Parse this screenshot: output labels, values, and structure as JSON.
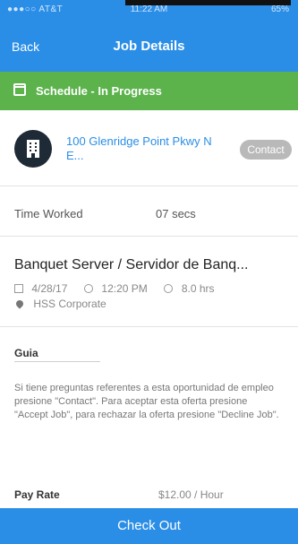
{
  "status_bar": {
    "carrier": "●●●○○ AT&T",
    "time": "11:22 AM",
    "battery": "65%"
  },
  "header": {
    "back_label": "Back",
    "title": "Job Details"
  },
  "schedule": {
    "label": "Schedule - In Progress"
  },
  "location": {
    "address": "100 Glenridge Point Pkwy N E...",
    "contact_label": "Contact"
  },
  "time_worked": {
    "label": "Time Worked",
    "value": "07 secs"
  },
  "job": {
    "title": "Banquet Server / Servidor de Banq...",
    "date": "4/28/17",
    "time": "12:20 PM",
    "hours": "8.0 hrs",
    "company": "HSS Corporate"
  },
  "guia": {
    "label": "Guia",
    "text": "Si tiene preguntas referentes a esta oportunidad de empleo presione \"Contact\". Para aceptar esta oferta presione \"Accept Job\", para rechazar la oferta presione \"Decline Job\"."
  },
  "pay": {
    "label": "Pay Rate",
    "value": "$12.00 / Hour"
  },
  "footer": {
    "checkout_label": "Check Out"
  },
  "colors": {
    "primary": "#2b8ee6",
    "success": "#5cb34c"
  }
}
